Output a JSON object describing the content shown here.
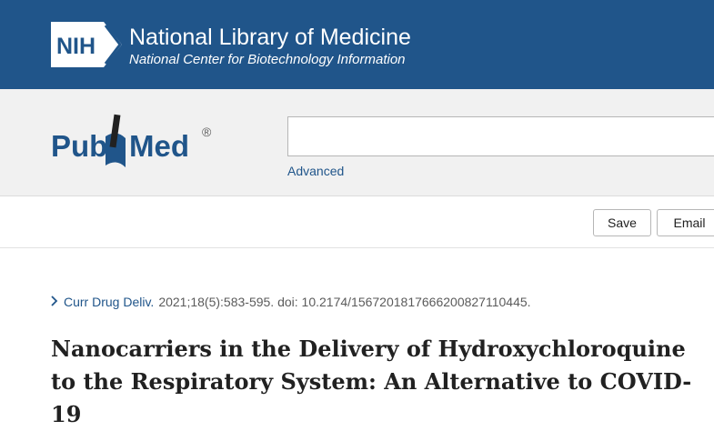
{
  "nih": {
    "logo_text": "NIH",
    "title": "National Library of Medicine",
    "subtitle": "National Center for Biotechnology Information"
  },
  "pubmed": {
    "logo_pub": "Pub",
    "logo_med": "Med",
    "logo_mark": "®"
  },
  "search": {
    "placeholder": "",
    "value": "",
    "advanced_label": "Advanced"
  },
  "toolbar": {
    "save_label": "Save",
    "email_label": "Email"
  },
  "article": {
    "journal": "Curr Drug Deliv.",
    "citation": "2021;18(5):583-595. doi: 10.2174/1567201817666200827110445.",
    "title": "Nanocarriers in the Delivery of Hydroxychloroquine to the Respiratory System: An Alternative to COVID-19"
  },
  "colors": {
    "nih_blue": "#20558a",
    "band_gray": "#f1f1f1",
    "link_blue": "#20558a",
    "text_dark": "#212121"
  }
}
